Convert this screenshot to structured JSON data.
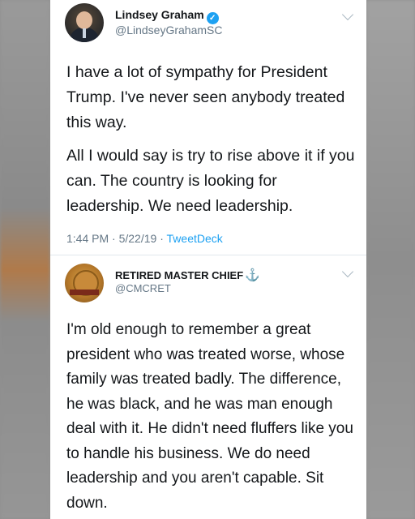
{
  "tweet1": {
    "author_name": "Lindsey Graham",
    "handle": "@LindseyGrahamSC",
    "verified": true,
    "paragraphs": [
      "I have a lot of sympathy for President Trump.  I've never seen anybody treated this way.",
      "All I would say is try to rise above it if you can.  The country is looking for leadership.  We need leadership."
    ],
    "time": "1:44 PM",
    "separator1": " · ",
    "date": "5/22/19",
    "separator2": " · ",
    "source": "TweetDeck"
  },
  "tweet2": {
    "author_name": "RETIRED MASTER CHIEF",
    "name_emoji": "⚓",
    "handle": "@CMCRET",
    "body": "I'm old enough to remember a great president who was treated worse, whose family was treated badly. The difference, he was black, and he was man enough deal with it.  He didn't need fluffers like you to handle his business. We do need leadership and you aren't capable. Sit down."
  },
  "colors": {
    "accent": "#1da1f2",
    "text": "#14171a",
    "secondary_text": "#657786"
  },
  "icons": {
    "verified": "verified-badge-icon",
    "chevron": "chevron-down-icon",
    "anchor": "anchor-icon"
  }
}
